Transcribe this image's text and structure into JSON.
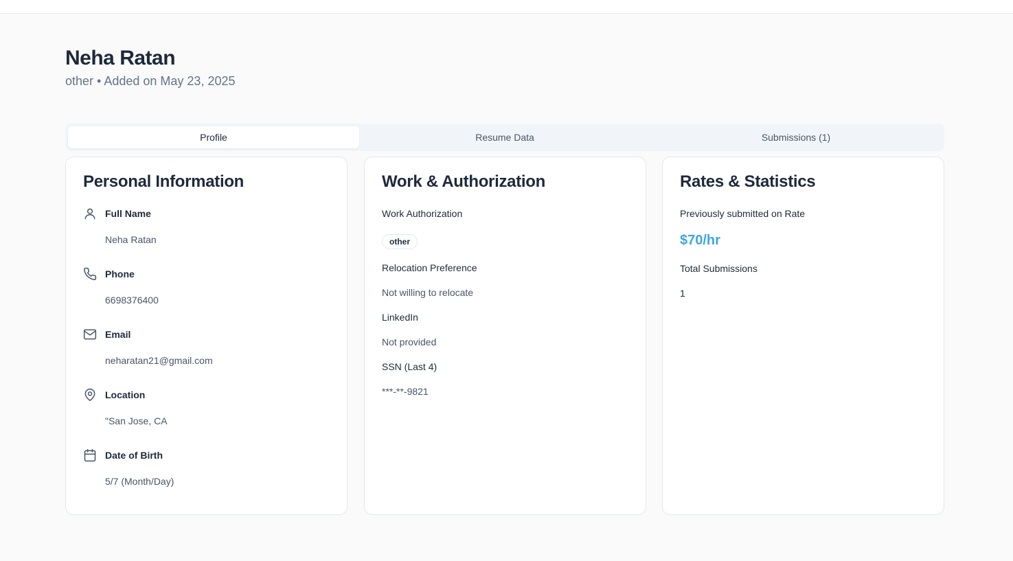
{
  "candidate": {
    "name": "Neha Ratan",
    "subtitle": "other • Added on May 23, 2025"
  },
  "tabs": [
    {
      "label": "Profile",
      "active": true
    },
    {
      "label": "Resume Data",
      "active": false
    },
    {
      "label": "Submissions (1)",
      "active": false
    }
  ],
  "personal": {
    "title": "Personal Information",
    "fields": [
      {
        "label": "Full Name",
        "value": "Neha Ratan",
        "icon": "user-icon"
      },
      {
        "label": "Phone",
        "value": "6698376400",
        "icon": "phone-icon"
      },
      {
        "label": "Email",
        "value": "neharatan21@gmail.com",
        "icon": "mail-icon"
      },
      {
        "label": "Location",
        "value": "\"San Jose, CA",
        "icon": "map-pin-icon"
      },
      {
        "label": "Date of Birth",
        "value": "5/7 (Month/Day)",
        "icon": "calendar-icon"
      }
    ]
  },
  "work": {
    "title": "Work & Authorization",
    "work_auth_label": "Work Authorization",
    "work_auth_badge": "other",
    "relocation_label": "Relocation Preference",
    "relocation_value": "Not willing to relocate",
    "linkedin_label": "LinkedIn",
    "linkedin_value": "Not provided",
    "ssn_label": "SSN (Last 4)",
    "ssn_value": "***-**-9821"
  },
  "rates": {
    "title": "Rates & Statistics",
    "rate_label": "Previously submitted on Rate",
    "rate_value": "$70/hr",
    "total_label": "Total Submissions",
    "total_value": "1"
  },
  "colors": {
    "accent": "#3ea7e0",
    "text_primary": "#1e293b",
    "text_muted": "#64748b",
    "tab_bg": "#f1f5f9",
    "border": "#e2e8f0"
  }
}
